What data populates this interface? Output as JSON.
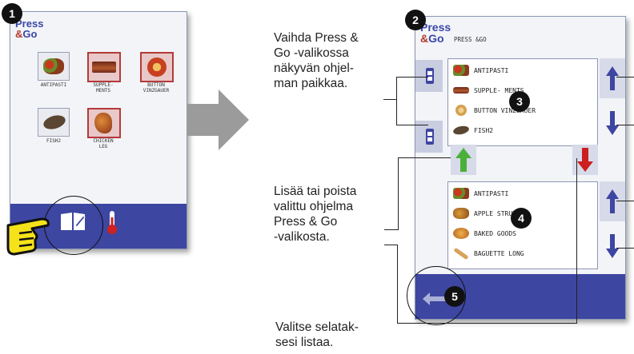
{
  "step_badges": [
    "1",
    "2",
    "3",
    "4",
    "5"
  ],
  "logo": {
    "line1": "Press",
    "amp": "&",
    "line2": "Go"
  },
  "screen1": {
    "tiles": [
      {
        "label_l1": "ANTIPASTI",
        "label_l2": "",
        "icon": "antipasti-icon"
      },
      {
        "label_l1": "SUPPLE-",
        "label_l2": "MENTS",
        "icon": "supplements-icon"
      },
      {
        "label_l1": "BUTTON",
        "label_l2": "VINZGAUER",
        "icon": "button-vinzgauer-icon"
      },
      {
        "label_l1": "FISH2",
        "label_l2": "",
        "icon": "fish-icon"
      },
      {
        "label_l1": "CHICKEN",
        "label_l2": "LEG",
        "icon": "chicken-leg-icon"
      }
    ],
    "bottom_icons": [
      "book-edit-icon",
      "thermometer-icon",
      "pointing-hand-icon"
    ]
  },
  "screen2": {
    "header_title": "PRESS &GO",
    "upper_list": [
      "ANTIPASTI",
      "SUPPLE- MENTS",
      "BUTTON VINZGAUER",
      "FISH2"
    ],
    "lower_list": [
      "ANTIPASTI",
      "APPLE STRUDEL",
      "BAKED GOODS",
      "BAGUETTE LONG"
    ],
    "icons": [
      "move-item-up-icon",
      "move-item-down-icon",
      "add-arrow-up-icon",
      "remove-arrow-down-icon",
      "scroll-up-icon",
      "scroll-down-icon",
      "back-arrow-icon"
    ]
  },
  "captions": {
    "top": [
      "Vaihda Press &",
      "Go -valikossa",
      "näkyvän ohjel-",
      "man paikkaa."
    ],
    "middle": [
      "Lisää tai poista",
      "valittu ohjelma",
      "Press & Go",
      "-valikosta."
    ],
    "bottom": [
      "Valitse selatak-",
      "sesi listaa."
    ]
  },
  "colors": {
    "brand_blue": "#3d46a1",
    "green_arrow": "#4caf3a",
    "red_arrow": "#cc1f1f",
    "hand_yellow": "#f5e21a"
  }
}
